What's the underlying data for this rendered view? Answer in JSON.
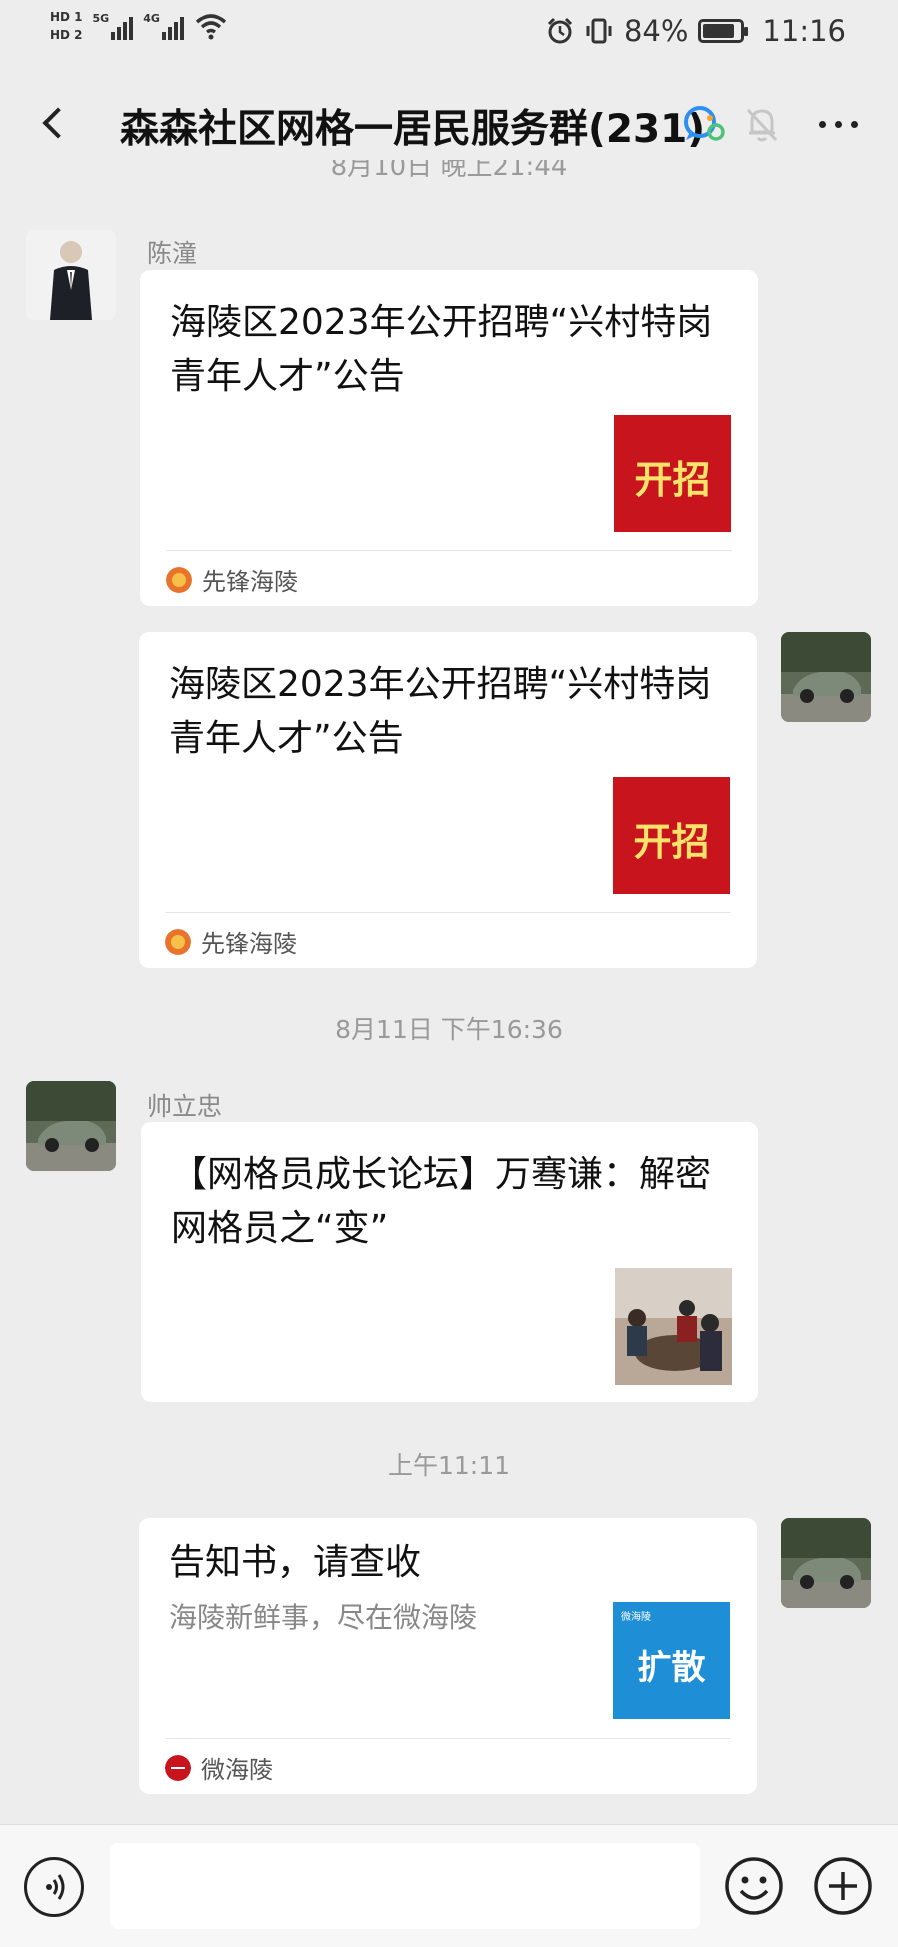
{
  "status_bar": {
    "sim1": "HD 1",
    "sim2": "HD 2",
    "net1": "5G",
    "net2": "4G",
    "battery_level": 0.84,
    "battery_text": "84%",
    "time": "11:16"
  },
  "header": {
    "title": "森森社区网格一居民服务群(231)"
  },
  "messages": {
    "prev_timestamp": "8月10日 晚上21:44",
    "m1": {
      "sender": "陈潼",
      "title": "海陵区2023年公开招聘“兴村特岗青年人才”公告",
      "thumb_text": "开招",
      "source": "先锋海陵"
    },
    "m2": {
      "title": "海陵区2023年公开招聘“兴村特岗青年人才”公告",
      "thumb_text": "开招",
      "source": "先锋海陵"
    },
    "ts2": "8月11日 下午16:36",
    "m3": {
      "sender": "帅立忠",
      "title": "【网格员成长论坛】万骞谦：解密网格员之“变”"
    },
    "ts3": "上午11:11",
    "m4": {
      "title": "告知书，请查收",
      "subtitle": "海陵新鲜事，尽在微海陵",
      "thumb_text": "扩散",
      "thumb_small": "微海陵",
      "source": "微海陵"
    }
  },
  "colors": {
    "background": "#ededed",
    "card": "#ffffff",
    "red_banner": "#c8141c",
    "blue_banner": "#1e8fd6"
  }
}
